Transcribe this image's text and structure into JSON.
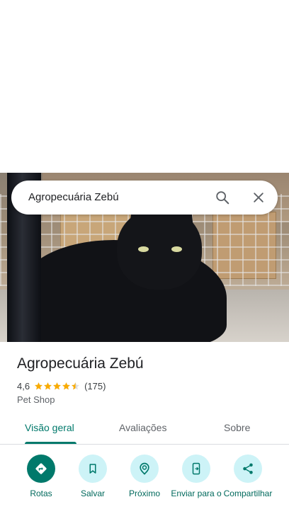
{
  "search": {
    "query": "Agropecuária Zebú"
  },
  "place": {
    "name": "Agropecuária Zebú",
    "rating": "4,6",
    "stars": 4.5,
    "review_count": "(175)",
    "category": "Pet Shop"
  },
  "tabs": [
    {
      "label": "Visão geral",
      "active": true
    },
    {
      "label": "Avaliações",
      "active": false
    },
    {
      "label": "Sobre",
      "active": false
    }
  ],
  "actions": [
    {
      "label": "Rotas",
      "icon": "directions-icon"
    },
    {
      "label": "Salvar",
      "icon": "bookmark-icon"
    },
    {
      "label": "Próximo",
      "icon": "nearby-icon"
    },
    {
      "label": "Enviar para o",
      "icon": "send-to-phone-icon"
    },
    {
      "label": "Compartilhar",
      "icon": "share-icon"
    }
  ],
  "colors": {
    "accent": "#00796b",
    "action_bg": "#cdf3f7",
    "star": "#f9ab00"
  }
}
